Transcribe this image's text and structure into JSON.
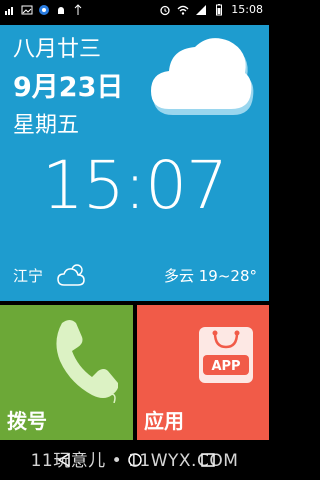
{
  "statusbar": {
    "time": "15:08"
  },
  "weather": {
    "lunar_date": "八月廿三",
    "date": "9月23日",
    "weekday": "星期五",
    "clock": "15:07",
    "city": "江宁",
    "forecast": "多云 19~28°"
  },
  "tiles": {
    "dial_label": "拨号",
    "apps_label": "应用",
    "app_badge": "APP"
  },
  "watermark": "11玩意儿 • 11WYX.COM",
  "colors": {
    "weather_bg": "#1e9ccf",
    "dial_bg": "#6ca837",
    "apps_bg": "#f15b48"
  }
}
